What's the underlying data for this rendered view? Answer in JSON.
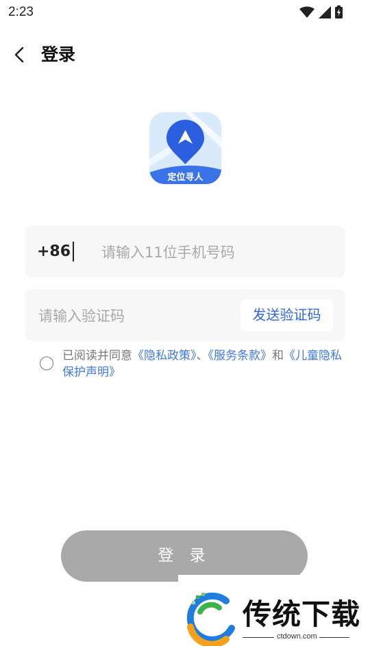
{
  "status_bar": {
    "time": "2:23"
  },
  "nav": {
    "title": "登录"
  },
  "logo": {
    "label": "定位寻人"
  },
  "phone": {
    "country_code": "+86",
    "placeholder": "请输入11位手机号码"
  },
  "code": {
    "placeholder": "请输入验证码",
    "send_label": "发送验证码"
  },
  "agreement": {
    "prefix": "已阅读并同意",
    "privacy_policy": "《隐私政策》",
    "separator": "、",
    "terms": "《服务条款》",
    "and": "和",
    "child_privacy": "《儿童隐私保护声明》"
  },
  "login_button": "登 录",
  "watermark": {
    "title": "传统下载",
    "url": "ctdown.com"
  },
  "colors": {
    "link": "#3f78e0",
    "accent": "#2f66d8",
    "login_disabled": "#a9a9a9",
    "field_bg": "#f7f7f7"
  }
}
